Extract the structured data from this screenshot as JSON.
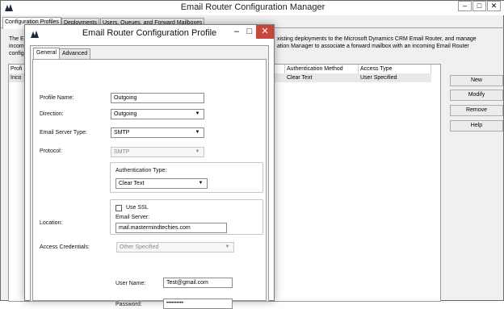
{
  "bg_window": {
    "title": "Email Router Configuration Manager",
    "controls": {
      "minimize": "–",
      "maximize": "□",
      "close": "✕"
    },
    "tabs": [
      "Configuration Profiles",
      "Deployments",
      "Users, Queues, and Forward Mailboxes"
    ],
    "desc_left": [
      "The E",
      "incom",
      "config"
    ],
    "desc_right": [
      "xisting deployments to the Microsoft Dynamics CRM Email Router, and manage",
      "ation Manager to associate a forward mailbox with an incoming Email Router"
    ],
    "table": {
      "headers": {
        "profile": "Profi",
        "auth_method": "Authentication Method",
        "access_type": "Access Type"
      },
      "row": {
        "profile": "Inco",
        "auth_method": "Clear Text",
        "access_type": "User Specified"
      }
    },
    "buttons": {
      "new": "New",
      "modify": "Modify",
      "remove": "Remove",
      "help": "Help"
    }
  },
  "dialog": {
    "title": "Email Router Configuration Profile",
    "controls": {
      "minimize": "–",
      "maximize": "□",
      "close": "✕"
    },
    "tabs": {
      "general": "General",
      "advanced": "Advanced"
    },
    "profile_name": {
      "label": "Profile Name:",
      "value": "Outgoing"
    },
    "direction": {
      "label": "Direction:",
      "value": "Outgoing"
    },
    "server_type": {
      "label": "Email Server Type:",
      "value": "SMTP"
    },
    "protocol": {
      "label": "Protocol:",
      "value": "SMTP"
    },
    "auth_type": {
      "label": "Authentication Type:",
      "value": "Clear Text"
    },
    "location": {
      "label": "Location:",
      "use_ssl_label": "Use SSL",
      "use_ssl_checked": false,
      "server_label": "Email Server:",
      "server_value": "mail.mastermindtechies.com"
    },
    "access_credentials": {
      "label": "Access Credentials:",
      "value": "Other Specified"
    },
    "user_name": {
      "label": "User Name:",
      "value": "Test@gmail.com"
    },
    "password": {
      "label": "Password:",
      "value": "••••••••••"
    }
  }
}
